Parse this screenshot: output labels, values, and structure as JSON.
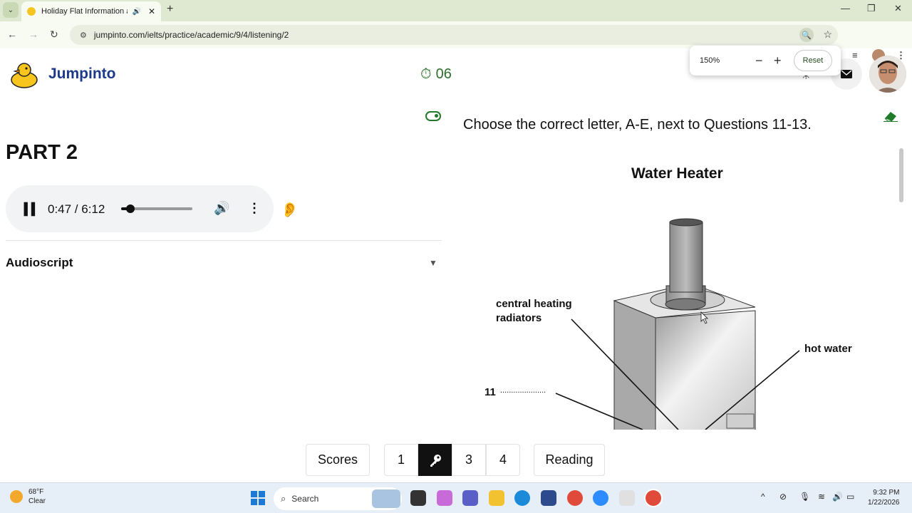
{
  "browser": {
    "tab_title": "Holiday Flat Information an",
    "url": "jumpinto.com/ielts/practice/academic/9/4/listening/2",
    "zoom_popup": {
      "value": "150%",
      "minus": "−",
      "plus": "+",
      "reset_label": "Reset"
    }
  },
  "header": {
    "brand": "Jumpinto",
    "timer": "06"
  },
  "left": {
    "part_title": "PART 2",
    "player": {
      "time": "0:47 / 6:12",
      "progress": 0.13
    },
    "audioscript_label": "Audioscript"
  },
  "right": {
    "instruction": "Choose the correct letter, A-E, next to Questions 11-13.",
    "diagram_title": "Water Heater",
    "labels": {
      "central_heating_1": "central heating",
      "central_heating_2": "radiators",
      "hot_water": "hot water",
      "q11": "11",
      "q11_dots": "....................."
    }
  },
  "bottom_nav": {
    "scores": "Scores",
    "p1": "1",
    "p3": "3",
    "p4": "4",
    "reading": "Reading"
  },
  "taskbar": {
    "temp": "68°F",
    "condition": "Clear",
    "search_placeholder": "Search",
    "time": "9:32 PM",
    "date": "1/22/2026"
  }
}
